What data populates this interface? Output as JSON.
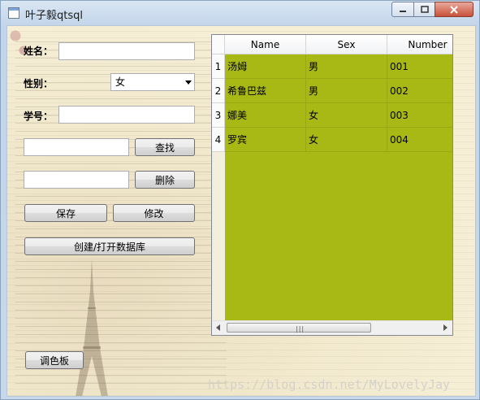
{
  "window": {
    "title": "叶子毅qtsql"
  },
  "form": {
    "name_label": "姓名：",
    "name_value": "",
    "gender_label": "性别：",
    "gender_selected": "女",
    "id_label": "学号：",
    "id_value": "",
    "search_value": "",
    "search_button": "查找",
    "delete_value": "",
    "delete_button": "删除",
    "save_button": "保存",
    "edit_button": "修改",
    "create_db_button": "创建/打开数据库",
    "palette_button": "调色板"
  },
  "table": {
    "columns": [
      "Name",
      "Sex",
      "Number"
    ],
    "rows": [
      {
        "index": "1",
        "name": "汤姆",
        "sex": "男",
        "number": "001"
      },
      {
        "index": "2",
        "name": "希鲁巴兹",
        "sex": "男",
        "number": "002"
      },
      {
        "index": "3",
        "name": "娜美",
        "sex": "女",
        "number": "003"
      },
      {
        "index": "4",
        "name": "罗宾",
        "sex": "女",
        "number": "004"
      }
    ],
    "row_color": "#a8b814"
  },
  "watermark": "https://blog.csdn.net/MyLovelyJay"
}
